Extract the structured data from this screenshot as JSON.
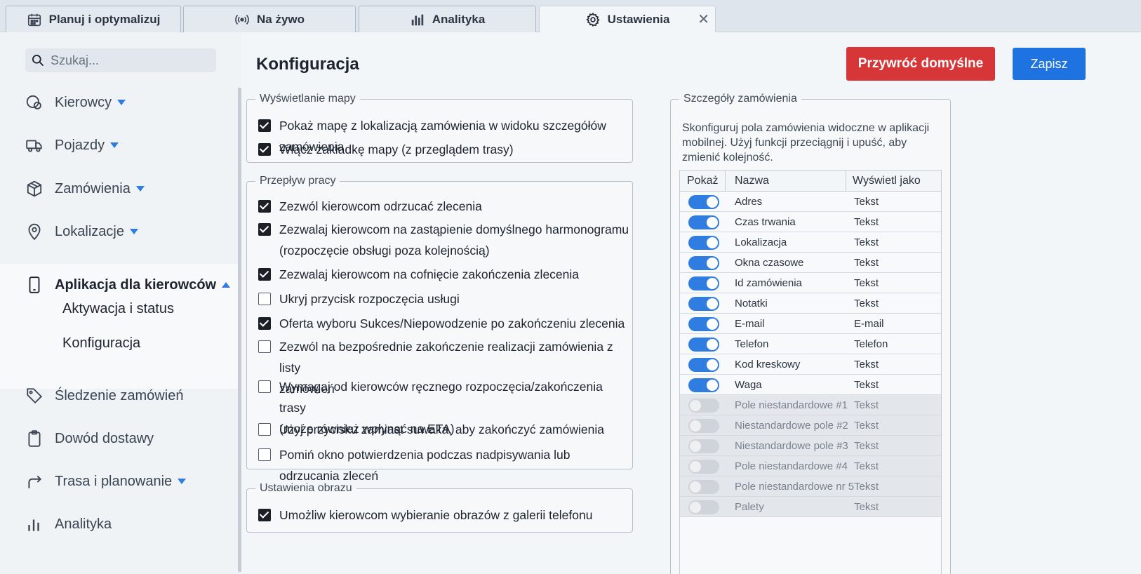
{
  "tabs": [
    {
      "label": "Planuj i optymalizuj",
      "icon": "calendar-icon"
    },
    {
      "label": "Na żywo",
      "icon": "live-broadcast-icon"
    },
    {
      "label": "Analityka",
      "icon": "bar-chart-icon"
    },
    {
      "label": "Ustawienia",
      "icon": "gear-icon",
      "active": true,
      "close": "✕"
    }
  ],
  "sidebar": {
    "search_placeholder": "Szukaj...",
    "items": [
      {
        "label": "Kierowcy",
        "icon": "steering-wheel-icon"
      },
      {
        "label": "Pojazdy",
        "icon": "truck-icon"
      },
      {
        "label": "Zamówienia",
        "icon": "package-icon"
      },
      {
        "label": "Lokalizacje",
        "icon": "location-pin-icon"
      },
      {
        "label": "Aplikacja dla kierowców",
        "icon": "smartphone-icon"
      },
      {
        "label": "Śledzenie zamówień",
        "icon": "tag-icon"
      },
      {
        "label": "Dowód dostawy",
        "icon": "clipboard-icon"
      },
      {
        "label": "Trasa i planowanie",
        "icon": "route-arrow-icon"
      },
      {
        "label": "Analityka",
        "icon": "bar-chart-icon"
      }
    ],
    "subitems": [
      "Aktywacja i status",
      "Konfiguracja"
    ]
  },
  "main": {
    "title": "Konfiguracja",
    "reset_label": "Przywróć domyślne",
    "save_label": "Zapisz",
    "map_section": {
      "legend": "Wyświetlanie mapy",
      "options": [
        {
          "label": "Pokaż mapę z lokalizacją zamówienia w widoku szczegółów zamówienia",
          "checked": true
        },
        {
          "label": "Włącz zakładkę mapy (z przeglądem trasy)",
          "checked": true
        }
      ]
    },
    "workflow_section": {
      "legend": "Przepływ pracy",
      "options": [
        {
          "label": "Zezwól kierowcom odrzucać zlecenia",
          "checked": true
        },
        {
          "label": "Zezwalaj kierowcom na zastąpienie domyślnego harmonogramu",
          "label2": "(rozpoczęcie obsługi poza kolejnością)",
          "checked": true
        },
        {
          "label": "Zezwalaj kierowcom na cofnięcie zakończenia zlecenia",
          "checked": true
        },
        {
          "label": "Ukryj przycisk rozpoczęcia usługi",
          "checked": false
        },
        {
          "label": "Oferta wyboru Sukces/Niepowodzenie po zakończeniu zlecenia",
          "checked": true
        },
        {
          "label": "Zezwól na bezpośrednie zakończenie realizacji zamówienia z listy",
          "label2": "zamówień",
          "checked": false
        },
        {
          "label": "Wymagaj od kierowców ręcznego rozpoczęcia/zakończenia trasy",
          "label2": "(może również wpłynąć na ETA)",
          "checked": false
        },
        {
          "label": "Użyj przycisku zamiast suwaka, aby zakończyć zamówienia",
          "checked": false
        },
        {
          "label": "Pomiń okno potwierdzenia podczas nadpisywania lub odrzucania zleceń",
          "checked": false
        }
      ]
    },
    "image_section": {
      "legend": "Ustawienia obrazu",
      "options": [
        {
          "label": "Umożliw kierowcom wybieranie obrazów z galerii telefonu",
          "checked": true
        }
      ]
    },
    "order_details": {
      "legend": "Szczegóły zamówienia",
      "description": "Skonfiguruj pola zamówienia widoczne w aplikacji mobilnej. Użyj funkcji przeciągnij i upuść, aby zmienić kolejność.",
      "columns": [
        "Pokaż",
        "Nazwa",
        "Wyświetl jako"
      ],
      "rows": [
        {
          "show": true,
          "name": "Adres",
          "display": "Tekst"
        },
        {
          "show": true,
          "name": "Czas trwania",
          "display": "Tekst"
        },
        {
          "show": true,
          "name": "Lokalizacja",
          "display": "Tekst"
        },
        {
          "show": true,
          "name": "Okna czasowe",
          "display": "Tekst"
        },
        {
          "show": true,
          "name": "Id zamówienia",
          "display": "Tekst"
        },
        {
          "show": true,
          "name": "Notatki",
          "display": "Tekst"
        },
        {
          "show": true,
          "name": "E-mail",
          "display": "E-mail"
        },
        {
          "show": true,
          "name": "Telefon",
          "display": "Telefon"
        },
        {
          "show": true,
          "name": "Kod kreskowy",
          "display": "Tekst"
        },
        {
          "show": true,
          "name": "Waga",
          "display": "Tekst"
        },
        {
          "show": false,
          "name": "Pole niestandardowe #1",
          "display": "Tekst"
        },
        {
          "show": false,
          "name": "Niestandardowe pole #2",
          "display": "Tekst"
        },
        {
          "show": false,
          "name": "Niestandardowe pole #3",
          "display": "Tekst"
        },
        {
          "show": false,
          "name": "Pole niestandardowe #4",
          "display": "Tekst"
        },
        {
          "show": false,
          "name": "Pole niestandardowe nr 5",
          "display": "Tekst"
        },
        {
          "show": false,
          "name": "Palety",
          "display": "Tekst"
        }
      ]
    }
  },
  "colors": {
    "accent": "#2f7de1",
    "danger": "#d63637",
    "save": "#1f73e0"
  }
}
